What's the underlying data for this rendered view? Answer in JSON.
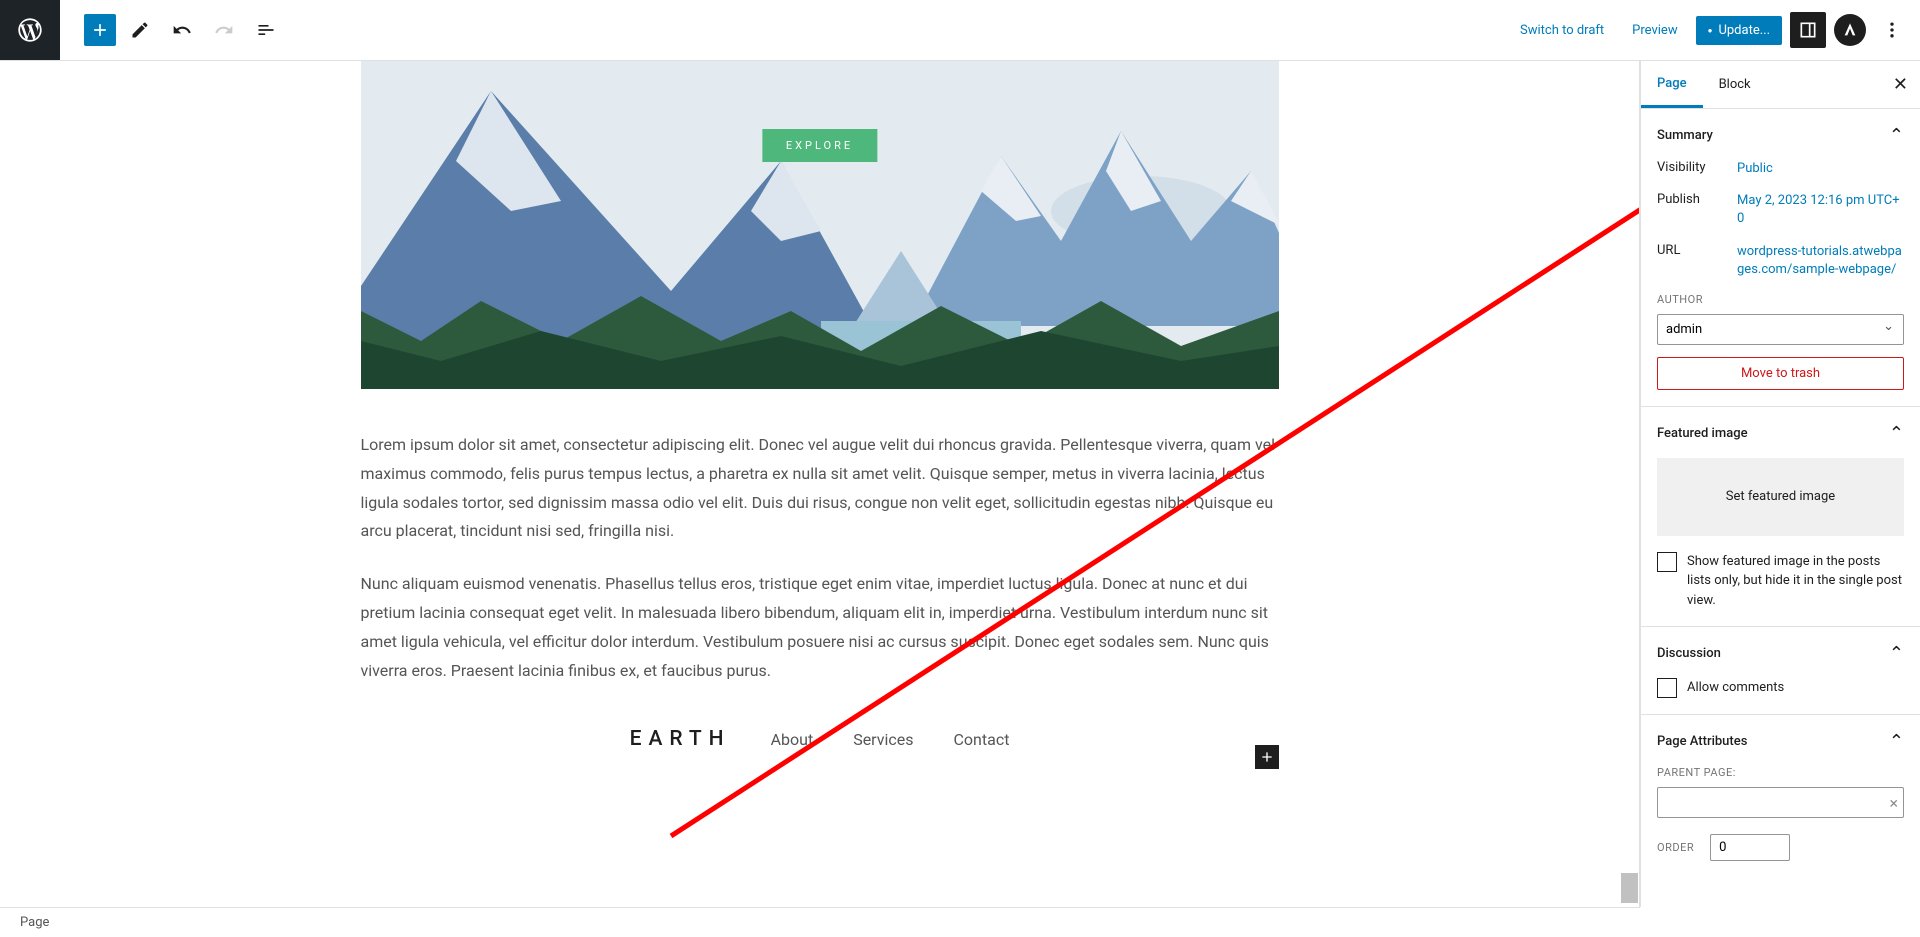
{
  "toolbar": {
    "switch_draft": "Switch to draft",
    "preview": "Preview",
    "update": "Update..."
  },
  "hero": {
    "explore": "EXPLORE"
  },
  "content": {
    "para1": "Lorem ipsum dolor sit amet, consectetur adipiscing elit. Donec vel augue velit dui rhoncus gravida. Pellentesque viverra, quam vel maximus commodo, felis purus tempus lectus, a pharetra ex nulla sit amet velit. Quisque semper, metus in viverra lacinia, lectus ligula sodales tortor, sed dignissim massa odio vel elit. Duis dui risus, congue non velit eget, sollicitudin egestas nibh. Quisque eu arcu placerat, tincidunt nisi sed, fringilla nisi.",
    "para2": "Nunc aliquam euismod venenatis. Phasellus tellus eros, tristique eget enim vitae, imperdiet luctus ligula. Donec at nunc et dui pretium lacinia consequat eget velit. In malesuada libero bibendum, aliquam elit in, imperdiet urna. Vestibulum interdum nunc sit amet ligula vehicula, vel efficitur dolor interdum. Vestibulum posuere nisi ac cursus suscipit. Donec eget sodales sem. Nunc quis viverra eros. Praesent lacinia finibus ex, et faucibus purus."
  },
  "footer_nav": {
    "brand": "EARTH",
    "links": [
      "About",
      "Services",
      "Contact"
    ]
  },
  "sidebar": {
    "tabs": {
      "page": "Page",
      "block": "Block"
    },
    "summary": {
      "title": "Summary",
      "visibility_label": "Visibility",
      "visibility_value": "Public",
      "publish_label": "Publish",
      "publish_value": "May 2, 2023 12:16 pm UTC+0",
      "url_label": "URL",
      "url_value": "wordpress-tutorials.atwebpages.com/sample-webpage/",
      "author_label": "AUTHOR",
      "author_value": "admin",
      "trash": "Move to trash"
    },
    "featured": {
      "title": "Featured image",
      "set": "Set featured image",
      "checkbox_text": "Show featured image in the posts lists only, but hide it in the single post view."
    },
    "discussion": {
      "title": "Discussion",
      "allow": "Allow comments"
    },
    "attributes": {
      "title": "Page Attributes",
      "parent_label": "PARENT PAGE:",
      "order_label": "ORDER",
      "order_value": "0"
    }
  },
  "breadcrumb": "Page"
}
